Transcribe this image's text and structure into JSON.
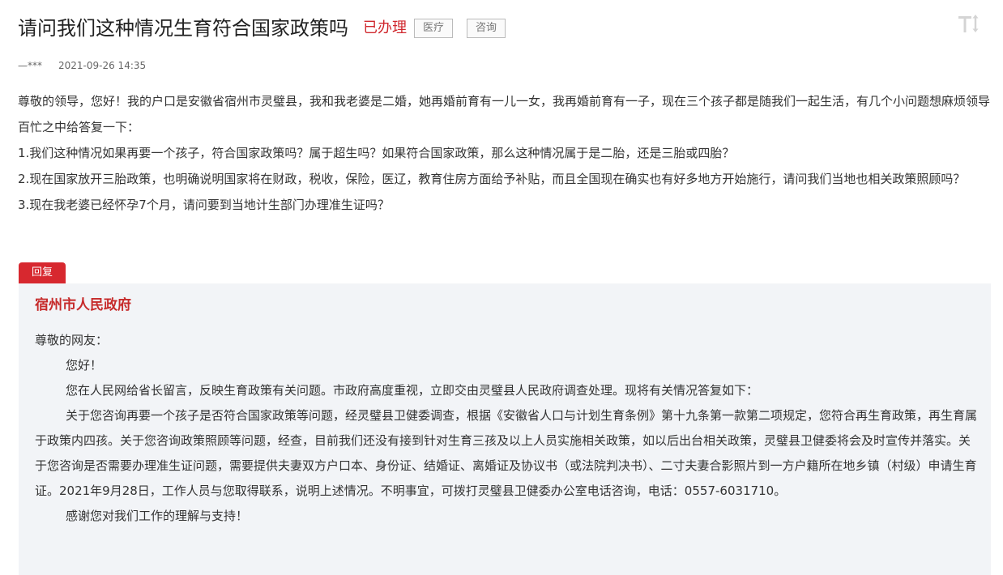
{
  "header": {
    "title": "请问我们这种情况生育符合国家政策吗",
    "status": "已办理",
    "tags": [
      "医疗",
      "咨询"
    ]
  },
  "meta": {
    "author": "—***",
    "date": "2021-09-26 14:35"
  },
  "question": {
    "paragraphs": [
      "尊敬的领导，您好！我的户口是安徽省宿州市灵璧县，我和我老婆是二婚，她再婚前育有一儿一女，我再婚前育有一子，现在三个孩子都是随我们一起生活，有几个小问题想麻烦领导百忙之中给答复一下：",
      "1.我们这种情况如果再要一个孩子，符合国家政策吗？属于超生吗？如果符合国家政策，那么这种情况属于是二胎，还是三胎或四胎？",
      "2.现在国家放开三胎政策，也明确说明国家将在财政，税收，保险，医辽，教育住房方面给予补贴，而且全国现在确实也有好多地方开始施行，请问我们当地也相关政策照顾吗？",
      "3.现在我老婆已经怀孕7个月，请问要到当地计生部门办理准生证吗？"
    ]
  },
  "reply": {
    "label": "回复",
    "org": "宿州市人民政府",
    "salutation": "尊敬的网友：",
    "greeting": "您好！",
    "paragraphs": [
      "您在人民网给省长留言，反映生育政策有关问题。市政府高度重视，立即交由灵璧县人民政府调查处理。现将有关情况答复如下：",
      "关于您咨询再要一个孩子是否符合国家政策等问题，经灵璧县卫健委调查，根据《安徽省人口与计划生育条例》第十九条第一款第二项规定，您符合再生育政策，再生育属于政策内四孩。关于您咨询政策照顾等问题，经查，目前我们还没有接到针对生育三孩及以上人员实施相关政策，如以后出台相关政策，灵璧县卫健委将会及时宣传并落实。关于您咨询是否需要办理准生证问题，需要提供夫妻双方户口本、身份证、结婚证、离婚证及协议书（或法院判决书）、二寸夫妻合影照片到一方户籍所在地乡镇（村级）申请生育证。2021年9月28日，工作人员与您取得联系，说明上述情况。不明事宜，可拨打灵璧县卫健委办公室电话咨询，电话：0557-6031710。",
      "感谢您对我们工作的理解与支持！"
    ]
  },
  "icons": {
    "font_toggle": "font-size-toggle-icon"
  },
  "colors": {
    "status": "#d0282e",
    "reply_label_bg": "#d7282f",
    "org_name": "#c62b2b",
    "reply_bg": "#f2f4f7"
  }
}
